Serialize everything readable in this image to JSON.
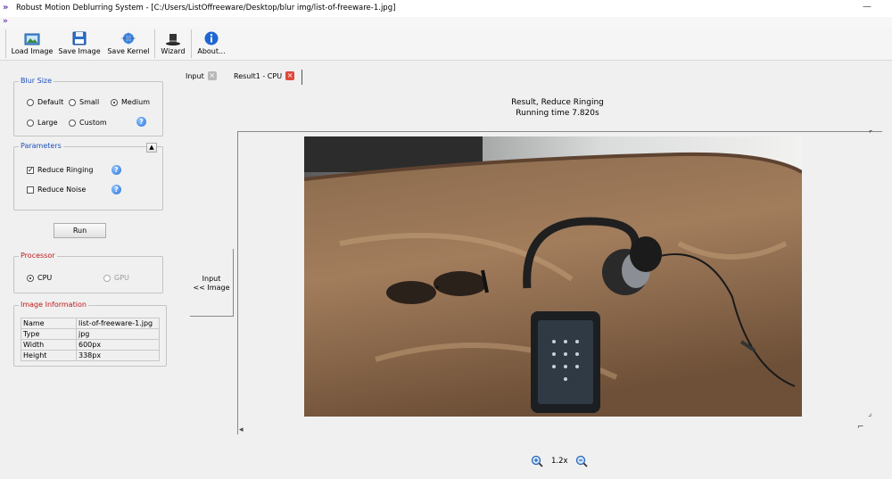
{
  "window": {
    "title": "Robust Motion Deblurring System - [C:/Users/ListOffreeware/Desktop/blur img/list-of-freeware-1.jpg]",
    "minimize_glyph": "—"
  },
  "toolbar": {
    "load_image": "Load Image",
    "save_image": "Save Image",
    "save_kernel": "Save Kernel",
    "wizard": "Wizard",
    "about": "About..."
  },
  "blur_size": {
    "label": "Blur Size",
    "options": [
      "Default",
      "Small",
      "Medium",
      "Large",
      "Custom"
    ],
    "selected": "Medium"
  },
  "parameters": {
    "label": "Parameters",
    "collapse_glyph": "▲",
    "reduce_ringing": "Reduce Ringing",
    "reduce_ringing_checked": true,
    "reduce_noise": "Reduce Noise",
    "reduce_noise_checked": false
  },
  "run": {
    "label": "Run"
  },
  "processor": {
    "label": "Processor",
    "cpu": "CPU",
    "gpu": "GPU",
    "selected": "CPU"
  },
  "image_info": {
    "label": "Image Information",
    "rows": [
      [
        "Name",
        "list-of-freeware-1.jpg"
      ],
      [
        "Type",
        "jpg"
      ],
      [
        "Width",
        "600px"
      ],
      [
        "Height",
        "338px"
      ]
    ]
  },
  "tabs": [
    {
      "label": "Input",
      "active": false
    },
    {
      "label": "Result1 - CPU",
      "active": true
    }
  ],
  "result": {
    "title": "Result, Reduce Ringing",
    "running_time": "Running time 7.820s"
  },
  "side_button": {
    "line1": "Input",
    "line2": "<< Image"
  },
  "zoom": {
    "level": "1.2x"
  },
  "colors": {
    "accent_blue": "#1c4fbd",
    "accent_red": "#c01818",
    "tab_close_red": "#e0483c"
  }
}
